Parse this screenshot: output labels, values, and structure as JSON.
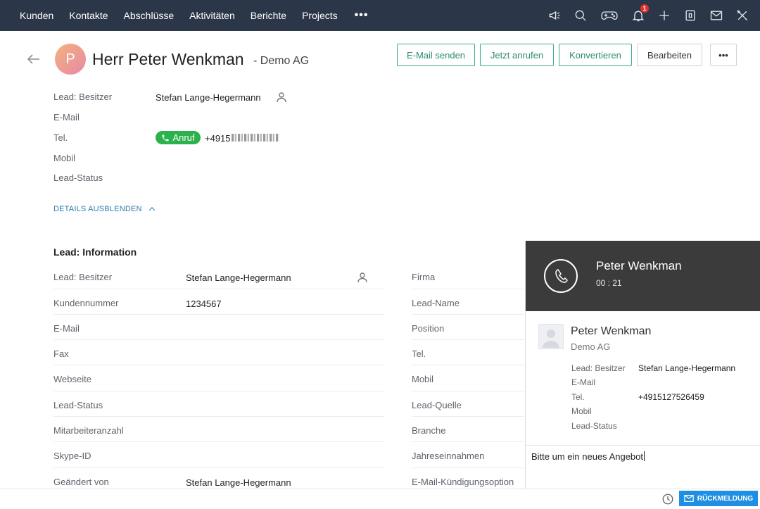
{
  "nav": {
    "items": [
      "Kunden",
      "Kontakte",
      "Abschlüsse",
      "Aktivitäten",
      "Berichte",
      "Projects"
    ],
    "more": "•••",
    "notification_count": "1",
    "icons": [
      "megaphone-icon",
      "search-icon",
      "gamepad-icon",
      "bell-icon",
      "plus-icon",
      "calendar-icon",
      "mail-icon",
      "settings-tools-icon"
    ]
  },
  "header": {
    "avatar_letter": "P",
    "title": "Herr Peter Wenkman",
    "company": "- Demo AG",
    "buttons": {
      "email": "E-Mail senden",
      "call": "Jetzt anrufen",
      "convert": "Konvertieren",
      "edit": "Bearbeiten",
      "more": "•••"
    }
  },
  "summary": {
    "owner_label": "Lead: Besitzer",
    "owner_value": "Stefan Lange-Hegermann",
    "email_label": "E-Mail",
    "phone_label": "Tel.",
    "call_pill": "Anruf",
    "phone_value": "+4915",
    "mobile_label": "Mobil",
    "status_label": "Lead-Status",
    "toggle_details": "DETAILS AUSBLENDEN"
  },
  "lead_info": {
    "title": "Lead: Information",
    "left": [
      {
        "label": "Lead: Besitzer",
        "value": "Stefan Lange-Hegermann"
      },
      {
        "label": "Kundennummer",
        "value": "1234567"
      },
      {
        "label": "E-Mail",
        "value": ""
      },
      {
        "label": "Fax",
        "value": ""
      },
      {
        "label": "Webseite",
        "value": ""
      },
      {
        "label": "Lead-Status",
        "value": ""
      },
      {
        "label": "Mitarbeiteranzahl",
        "value": ""
      },
      {
        "label": "Skype-ID",
        "value": ""
      },
      {
        "label": "Geändert von",
        "value": "Stefan Lange-Hegermann"
      }
    ],
    "right": [
      "Firma",
      "Lead-Name",
      "Position",
      "Tel.",
      "Mobil",
      "Lead-Quelle",
      "Branche",
      "Jahreseinnahmen",
      "E-Mail-Kündigungsoption"
    ]
  },
  "call_panel": {
    "name": "Peter Wenkman",
    "timer": "00 : 21",
    "contact_name": "Peter Wenkman",
    "contact_company": "Demo AG",
    "fields": [
      {
        "label": "Lead: Besitzer",
        "value": "Stefan Lange-Hegermann"
      },
      {
        "label": "E-Mail",
        "value": ""
      },
      {
        "label": "Tel.",
        "value": "+4915127526459"
      },
      {
        "label": "Mobil",
        "value": ""
      },
      {
        "label": "Lead-Status",
        "value": ""
      }
    ],
    "note": "Bitte um ein neues Angebot"
  },
  "footer": {
    "feedback": "RÜCKMELDUNG"
  }
}
